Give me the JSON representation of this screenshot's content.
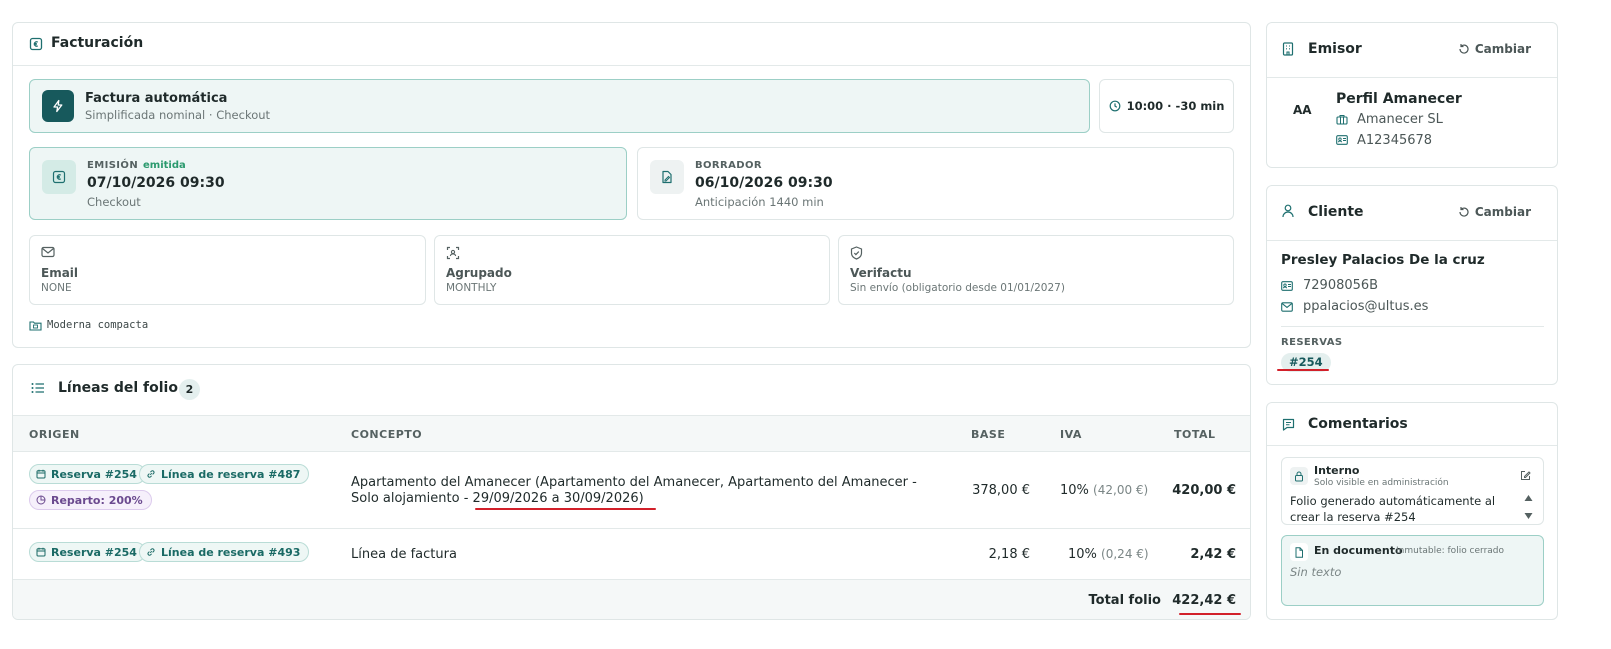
{
  "facturacion": {
    "title": "Facturación",
    "auto_invoice": {
      "title": "Factura automática",
      "subtitle": "Simplificada nominal · Checkout"
    },
    "schedule": "10:00 · -30 min",
    "emision": {
      "label": "EMISIÓN",
      "badge": "emitida",
      "date": "07/10/2026 09:30",
      "sub": "Checkout"
    },
    "borrador": {
      "label": "BORRADOR",
      "date": "06/10/2026 09:30",
      "sub": "Anticipación 1440 min"
    },
    "email": {
      "label": "Email",
      "value": "NONE"
    },
    "agrupado": {
      "label": "Agrupado",
      "value": "MONTHLY"
    },
    "verifactu": {
      "label": "Verifactu",
      "value": "Sin envío (obligatorio desde 01/01/2027)"
    },
    "template": "Moderna compacta"
  },
  "lineas": {
    "title": "Líneas del folio",
    "count": "2",
    "headers": {
      "origen": "ORIGEN",
      "concepto": "CONCEPTO",
      "base": "BASE",
      "iva": "IVA",
      "total": "TOTAL"
    },
    "rows": [
      {
        "chips": [
          "Reserva #254",
          "Línea de reserva #487"
        ],
        "reparto": "Reparto: 200%",
        "concept_line1": "Apartamento del Amanecer (Apartamento del Amanecer, Apartamento del Amanecer -",
        "concept_line2_a": "Solo alojamiento - ",
        "concept_line2_b": "29/09/2026 a 30/09/2026",
        "concept_line2_c": ")",
        "base": "378,00 €",
        "iva_pct": "10%",
        "iva_amount": "(42,00 €)",
        "total": "420,00 €"
      },
      {
        "chips": [
          "Reserva #254",
          "Línea de reserva #493"
        ],
        "concept": "Línea de factura",
        "base": "2,18 €",
        "iva_pct": "10%",
        "iva_amount": "(0,24 €)",
        "total": "2,42 €"
      }
    ],
    "total_label": "Total folio",
    "total_value": "422,42 €"
  },
  "emisor": {
    "title": "Emisor",
    "change": "Cambiar",
    "initials": "AA",
    "profile": "Perfil Amanecer",
    "company": "Amanecer SL",
    "tax_id": "A12345678"
  },
  "cliente": {
    "title": "Cliente",
    "change": "Cambiar",
    "name": "Presley Palacios De la cruz",
    "doc_id": "72908056B",
    "email": "ppalacios@ultus.es",
    "reservas_label": "RESERVAS",
    "reserva": "#254"
  },
  "comentarios": {
    "title": "Comentarios",
    "interno": {
      "label": "Interno",
      "sub": "Solo visible en administración",
      "text": "Folio generado automáticamente al crear la reserva #254"
    },
    "documento": {
      "label": "En documento",
      "sub": "Inmutable: folio cerrado",
      "placeholder": "Sin texto"
    }
  },
  "colors": {
    "accent": "#1e6f6f",
    "accent_dark": "#17595c",
    "emitida": "#2b9a6e",
    "annotation_red": "#d2202a"
  }
}
